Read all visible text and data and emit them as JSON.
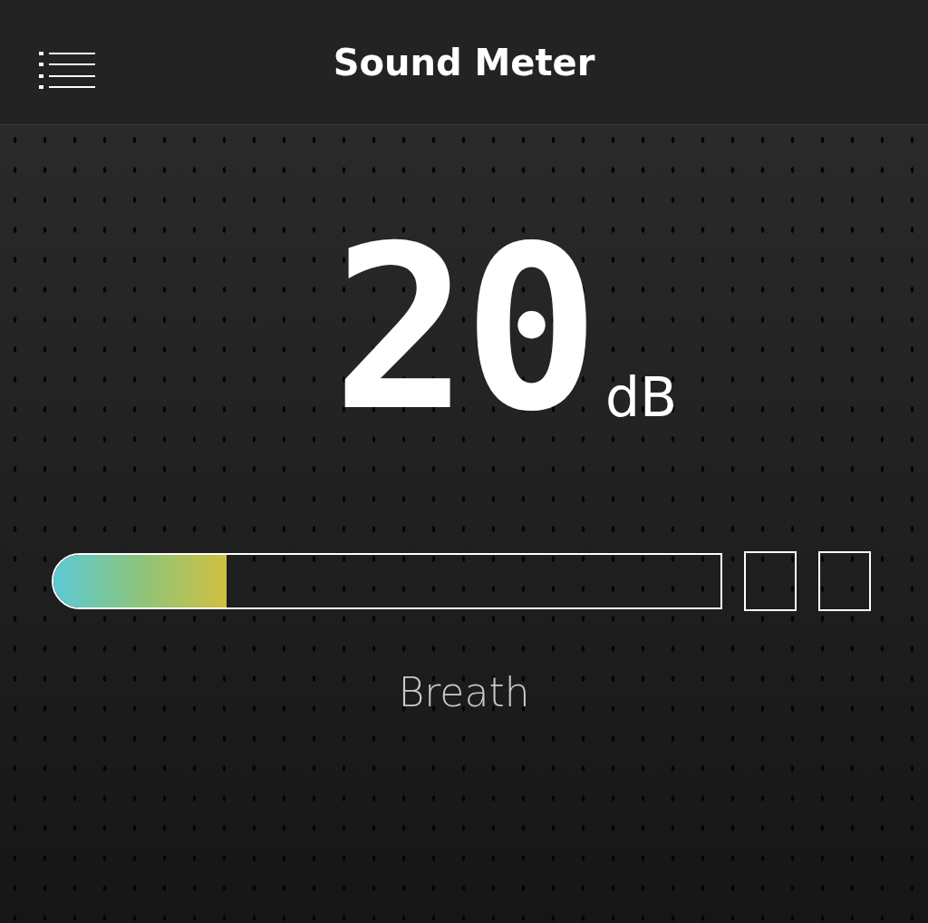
{
  "header": {
    "title": "Sound Meter"
  },
  "reading": {
    "value": "20",
    "unit": "dB"
  },
  "meter": {
    "level": 0.26,
    "segments": [
      {
        "on": false
      },
      {
        "on": false
      }
    ]
  },
  "status": "Breath"
}
